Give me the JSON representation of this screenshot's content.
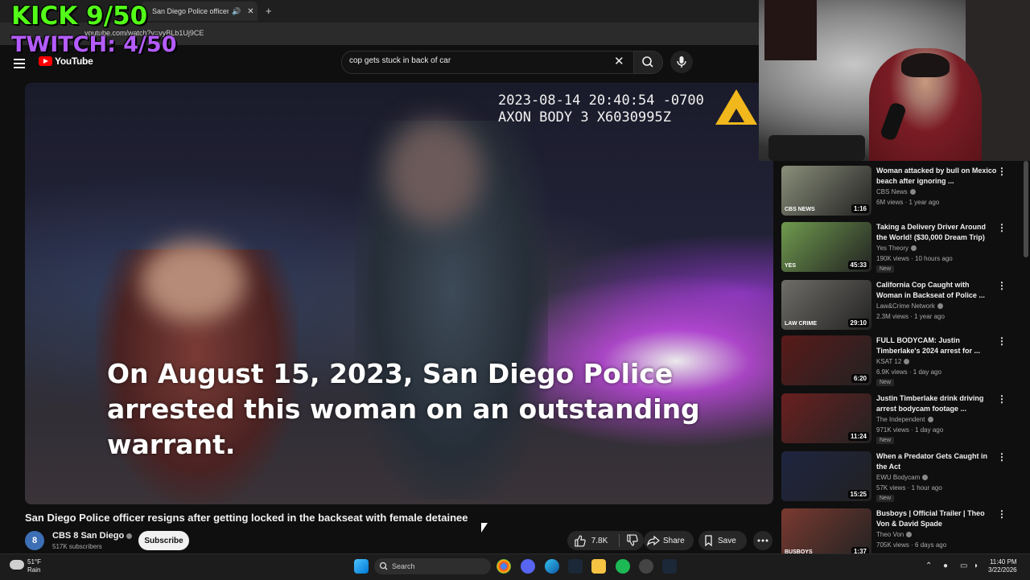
{
  "browser": {
    "tab_title": "San Diego Police officer res",
    "tab_mute_icon": "speaker-icon",
    "tab_close": "✕",
    "new_tab": "+",
    "url": "youtube.com/watch?v=vyBLb1Uj9CE"
  },
  "overlay": {
    "kick": "KICK 9/50",
    "twitch": "TWITCH: 4/50"
  },
  "youtube": {
    "logo_text": "YouTube",
    "search_value": "cop gets stuck in back of car",
    "clear": "✕"
  },
  "video": {
    "timestamp_line1": "2023-08-14 20:40:54 -0700",
    "timestamp_line2": "AXON BODY 3 X6030995Z",
    "caption": "On August 15, 2023, San Diego Police arrested this woman on an outstanding warrant.",
    "title": "San Diego Police officer resigns after getting locked in the backseat with female detainee"
  },
  "channel": {
    "avatar_text": "8",
    "name": "CBS 8 San Diego",
    "subscribers": "517K subscribers",
    "subscribe_label": "Subscribe"
  },
  "actions": {
    "likes": "7.8K",
    "share_label": "Share",
    "save_label": "Save"
  },
  "recommendations": [
    {
      "title": "Woman attacked by bull on Mexico beach after ignoring ...",
      "channel": "CBS News",
      "meta": "6M views · 1 year ago",
      "duration": "1:16",
      "badge": "",
      "thumb_label": "CBS NEWS",
      "thumb_color": "#8a8f7a"
    },
    {
      "title": "Taking a Delivery Driver Around the World! ($30,000 Dream Trip)",
      "channel": "Yes Theory",
      "meta": "190K views · 10 hours ago",
      "duration": "45:33",
      "badge": "New",
      "thumb_label": "YES",
      "thumb_color": "#6f9a4e"
    },
    {
      "title": "California Cop Caught with Woman in Backseat of Police ...",
      "channel": "Law&Crime Network",
      "meta": "2.3M views · 1 year ago",
      "duration": "29:10",
      "badge": "",
      "thumb_label": "LAW CRIME",
      "thumb_color": "#6f6d68"
    },
    {
      "title": "FULL BODYCAM: Justin Timberlake's 2024 arrest for ...",
      "channel": "KSAT 12",
      "meta": "6.9K views · 1 day ago",
      "duration": "6:20",
      "badge": "New",
      "thumb_label": "",
      "thumb_color": "#5a1a1a"
    },
    {
      "title": "Justin Timberlake drink driving arrest bodycam footage ...",
      "channel": "The Independent",
      "meta": "971K views · 1 day ago",
      "duration": "11:24",
      "badge": "New",
      "thumb_label": "",
      "thumb_color": "#6a2020"
    },
    {
      "title": "When a Predator Gets Caught in the Act",
      "channel": "EWU Bodycam",
      "meta": "57K views · 1 hour ago",
      "duration": "15:25",
      "badge": "New",
      "thumb_label": "",
      "thumb_color": "#1e2440"
    },
    {
      "title": "Busboys | Official Trailer | Theo Von & David Spade",
      "channel": "Theo Von",
      "meta": "705K views · 6 days ago",
      "duration": "1:37",
      "badge": "",
      "thumb_label": "BUSBOYS",
      "thumb_color": "#7a3a30"
    }
  ],
  "taskbar": {
    "temperature": "51°F",
    "weather": "Rain",
    "search_placeholder": "Search",
    "time": "11:40 PM",
    "date": "3/22/2026"
  }
}
